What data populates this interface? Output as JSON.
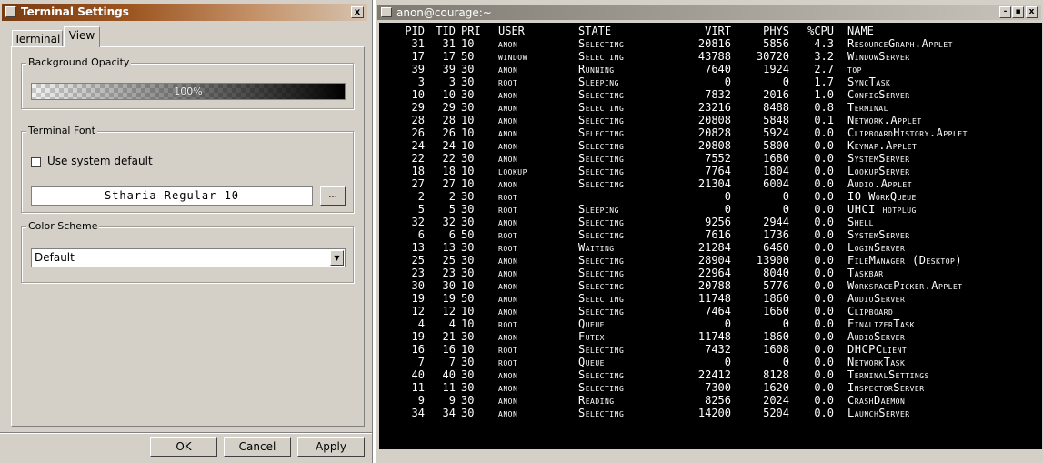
{
  "settings": {
    "title": "Terminal Settings",
    "close_glyph": "x",
    "tabs": [
      {
        "label": "Terminal",
        "active": false
      },
      {
        "label": "View",
        "active": true
      }
    ],
    "opacity": {
      "group_label": "Background Opacity",
      "value_label": "100%",
      "value": 1.0
    },
    "font": {
      "group_label": "Terminal Font",
      "use_system_default_label": "Use system default",
      "use_system_default_checked": false,
      "current_font": "Stharia Regular 10",
      "browse_label": "..."
    },
    "scheme": {
      "group_label": "Color Scheme",
      "selected": "Default"
    },
    "buttons": {
      "ok": "OK",
      "cancel": "Cancel",
      "apply": "Apply"
    }
  },
  "terminal": {
    "title": "anon@courage:~",
    "buttons": {
      "minimize": "-",
      "maximize": "▪",
      "close": "x"
    },
    "headers": {
      "pid": "PID",
      "tid": "TID",
      "pri": "PRI",
      "user": "USER",
      "state": "STATE",
      "virt": "VIRT",
      "phys": "PHYS",
      "cpu": "%CPU",
      "name": "NAME"
    },
    "rows": [
      {
        "pid": "31",
        "tid": "31",
        "pri": "10",
        "user": "anon",
        "state": "Selecting",
        "virt": "20816",
        "phys": "5856",
        "cpu": "4.3",
        "name": "ResourceGraph.Applet"
      },
      {
        "pid": "17",
        "tid": "17",
        "pri": "50",
        "user": "window",
        "state": "Selecting",
        "virt": "43788",
        "phys": "30720",
        "cpu": "3.2",
        "name": "WindowServer"
      },
      {
        "pid": "39",
        "tid": "39",
        "pri": "30",
        "user": "anon",
        "state": "Running",
        "virt": "7640",
        "phys": "1924",
        "cpu": "2.7",
        "name": "top"
      },
      {
        "pid": "3",
        "tid": "3",
        "pri": "30",
        "user": "root",
        "state": "Sleeping",
        "virt": "0",
        "phys": "0",
        "cpu": "1.7",
        "name": "SyncTask"
      },
      {
        "pid": "10",
        "tid": "10",
        "pri": "30",
        "user": "anon",
        "state": "Selecting",
        "virt": "7832",
        "phys": "2016",
        "cpu": "1.0",
        "name": "ConfigServer"
      },
      {
        "pid": "29",
        "tid": "29",
        "pri": "30",
        "user": "anon",
        "state": "Selecting",
        "virt": "23216",
        "phys": "8488",
        "cpu": "0.8",
        "name": "Terminal"
      },
      {
        "pid": "28",
        "tid": "28",
        "pri": "10",
        "user": "anon",
        "state": "Selecting",
        "virt": "20808",
        "phys": "5848",
        "cpu": "0.1",
        "name": "Network.Applet"
      },
      {
        "pid": "26",
        "tid": "26",
        "pri": "10",
        "user": "anon",
        "state": "Selecting",
        "virt": "20828",
        "phys": "5924",
        "cpu": "0.0",
        "name": "ClipboardHistory.Applet"
      },
      {
        "pid": "24",
        "tid": "24",
        "pri": "10",
        "user": "anon",
        "state": "Selecting",
        "virt": "20808",
        "phys": "5800",
        "cpu": "0.0",
        "name": "Keymap.Applet"
      },
      {
        "pid": "22",
        "tid": "22",
        "pri": "30",
        "user": "anon",
        "state": "Selecting",
        "virt": "7552",
        "phys": "1680",
        "cpu": "0.0",
        "name": "SystemServer"
      },
      {
        "pid": "18",
        "tid": "18",
        "pri": "10",
        "user": "lookup",
        "state": "Selecting",
        "virt": "7764",
        "phys": "1804",
        "cpu": "0.0",
        "name": "LookupServer"
      },
      {
        "pid": "27",
        "tid": "27",
        "pri": "10",
        "user": "anon",
        "state": "Selecting",
        "virt": "21304",
        "phys": "6004",
        "cpu": "0.0",
        "name": "Audio.Applet"
      },
      {
        "pid": "2",
        "tid": "2",
        "pri": "30",
        "user": "root",
        "state": "",
        "virt": "0",
        "phys": "0",
        "cpu": "0.0",
        "name": "IO WorkQueue"
      },
      {
        "pid": "5",
        "tid": "5",
        "pri": "30",
        "user": "root",
        "state": "Sleeping",
        "virt": "0",
        "phys": "0",
        "cpu": "0.0",
        "name": "UHCI hotplug"
      },
      {
        "pid": "32",
        "tid": "32",
        "pri": "30",
        "user": "anon",
        "state": "Selecting",
        "virt": "9256",
        "phys": "2944",
        "cpu": "0.0",
        "name": "Shell"
      },
      {
        "pid": "6",
        "tid": "6",
        "pri": "50",
        "user": "root",
        "state": "Selecting",
        "virt": "7616",
        "phys": "1736",
        "cpu": "0.0",
        "name": "SystemServer"
      },
      {
        "pid": "13",
        "tid": "13",
        "pri": "30",
        "user": "root",
        "state": "Waiting",
        "virt": "21284",
        "phys": "6460",
        "cpu": "0.0",
        "name": "LoginServer"
      },
      {
        "pid": "25",
        "tid": "25",
        "pri": "30",
        "user": "anon",
        "state": "Selecting",
        "virt": "28904",
        "phys": "13900",
        "cpu": "0.0",
        "name": "FileManager (Desktop)"
      },
      {
        "pid": "23",
        "tid": "23",
        "pri": "30",
        "user": "anon",
        "state": "Selecting",
        "virt": "22964",
        "phys": "8040",
        "cpu": "0.0",
        "name": "Taskbar"
      },
      {
        "pid": "30",
        "tid": "30",
        "pri": "10",
        "user": "anon",
        "state": "Selecting",
        "virt": "20788",
        "phys": "5776",
        "cpu": "0.0",
        "name": "WorkspacePicker.Applet"
      },
      {
        "pid": "19",
        "tid": "19",
        "pri": "50",
        "user": "anon",
        "state": "Selecting",
        "virt": "11748",
        "phys": "1860",
        "cpu": "0.0",
        "name": "AudioServer"
      },
      {
        "pid": "12",
        "tid": "12",
        "pri": "10",
        "user": "anon",
        "state": "Selecting",
        "virt": "7464",
        "phys": "1660",
        "cpu": "0.0",
        "name": "Clipboard"
      },
      {
        "pid": "4",
        "tid": "4",
        "pri": "10",
        "user": "root",
        "state": "Queue",
        "virt": "0",
        "phys": "0",
        "cpu": "0.0",
        "name": "FinalizerTask"
      },
      {
        "pid": "19",
        "tid": "21",
        "pri": "30",
        "user": "anon",
        "state": "Futex",
        "virt": "11748",
        "phys": "1860",
        "cpu": "0.0",
        "name": "AudioServer"
      },
      {
        "pid": "16",
        "tid": "16",
        "pri": "10",
        "user": "root",
        "state": "Selecting",
        "virt": "7432",
        "phys": "1608",
        "cpu": "0.0",
        "name": "DHCPClient"
      },
      {
        "pid": "7",
        "tid": "7",
        "pri": "30",
        "user": "root",
        "state": "Queue",
        "virt": "0",
        "phys": "0",
        "cpu": "0.0",
        "name": "NetworkTask"
      },
      {
        "pid": "40",
        "tid": "40",
        "pri": "30",
        "user": "anon",
        "state": "Selecting",
        "virt": "22412",
        "phys": "8128",
        "cpu": "0.0",
        "name": "TerminalSettings"
      },
      {
        "pid": "11",
        "tid": "11",
        "pri": "30",
        "user": "anon",
        "state": "Selecting",
        "virt": "7300",
        "phys": "1620",
        "cpu": "0.0",
        "name": "InspectorServer"
      },
      {
        "pid": "9",
        "tid": "9",
        "pri": "30",
        "user": "anon",
        "state": "Reading",
        "virt": "8256",
        "phys": "2024",
        "cpu": "0.0",
        "name": "CrashDaemon"
      },
      {
        "pid": "34",
        "tid": "34",
        "pri": "30",
        "user": "anon",
        "state": "Selecting",
        "virt": "14200",
        "phys": "5204",
        "cpu": "0.0",
        "name": "LaunchServer"
      }
    ]
  }
}
